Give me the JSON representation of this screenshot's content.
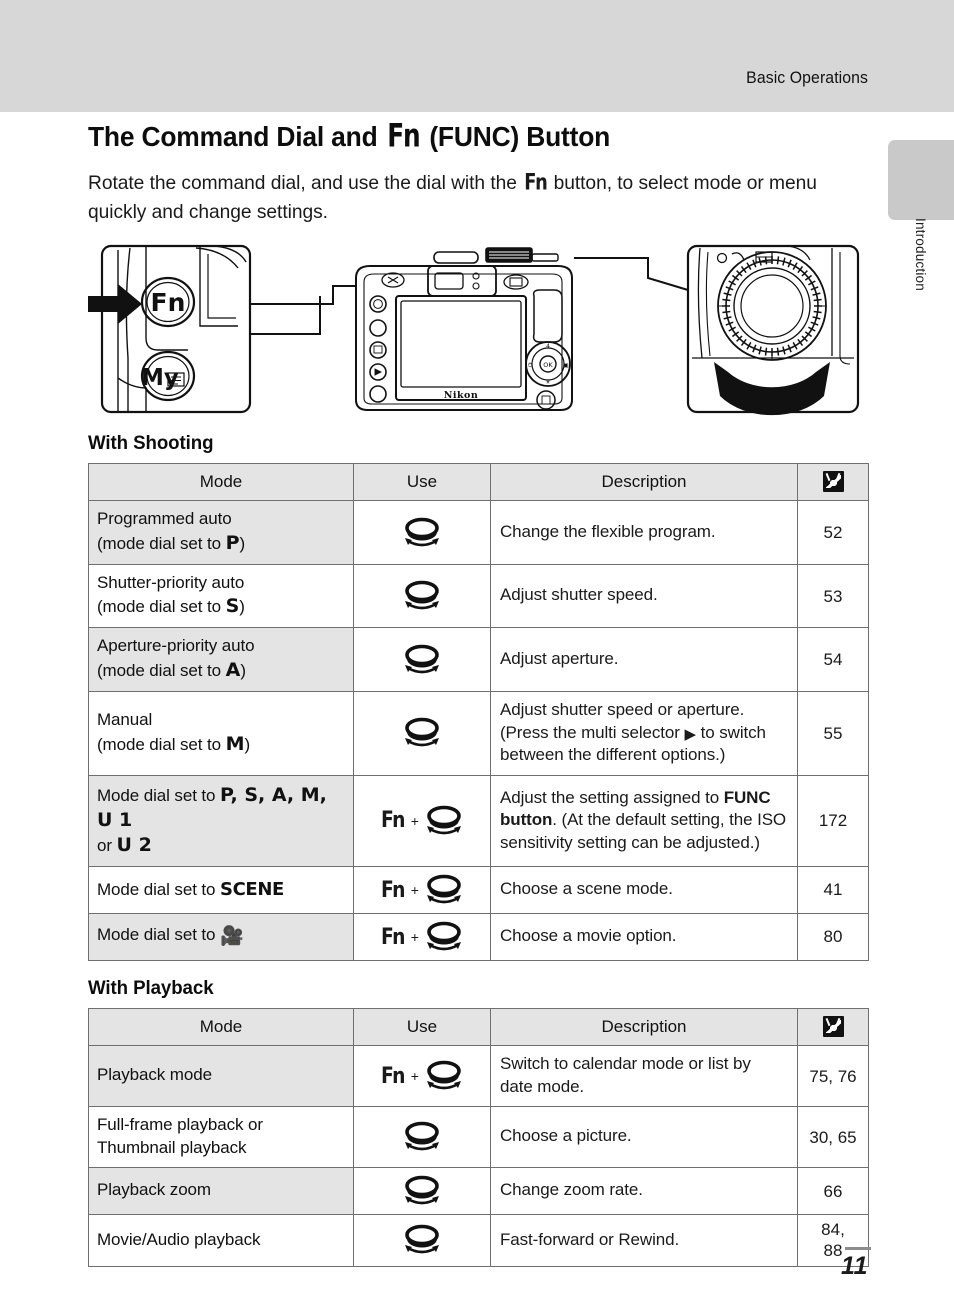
{
  "header": {
    "running_head": "Basic Operations"
  },
  "side_tab": {
    "label": "Introduction"
  },
  "section": {
    "title_before": "The Command Dial and ",
    "title_fn": "Fn",
    "title_after": " (FUNC) Button",
    "intro_before": "Rotate the command dial, and use the dial with the ",
    "intro_fn": "Fn",
    "intro_after": " button, to select mode or menu quickly and change settings."
  },
  "figure": {
    "name": "camera-command-dial-diagram",
    "fn_button_label": "Fn",
    "my_button_label": "My",
    "brand_label": "Nikon"
  },
  "shooting": {
    "heading": "With Shooting",
    "columns": [
      "Mode",
      "Use",
      "Description",
      "book-icon"
    ],
    "rows": [
      {
        "mode_line1": "Programmed auto",
        "mode_line2_before": "(mode dial set to ",
        "mode_letter": "P",
        "mode_line2_after": ")",
        "use": "dial",
        "desc": "Change the flexible program.",
        "page": "52"
      },
      {
        "mode_line1": "Shutter-priority auto",
        "mode_line2_before": "(mode dial set to ",
        "mode_letter": "S",
        "mode_line2_after": ")",
        "use": "dial",
        "desc": "Adjust shutter speed.",
        "page": "53"
      },
      {
        "mode_line1": "Aperture-priority auto",
        "mode_line2_before": "(mode dial set to ",
        "mode_letter": "A",
        "mode_line2_after": ")",
        "use": "dial",
        "desc": "Adjust aperture.",
        "page": "54"
      },
      {
        "mode_line1": "Manual",
        "mode_line2_before": "(mode dial set to ",
        "mode_letter": "M",
        "mode_line2_after": ")",
        "use": "dial",
        "desc_part1": "Adjust shutter speed or aperture. (Press the multi selector ",
        "desc_arrow": "▶",
        "desc_part2": " to switch between the different options.)",
        "page": "55"
      },
      {
        "mode_prefix": "Mode dial set to ",
        "mode_letters": "P, S, A, M, U 1",
        "mode_or": "or",
        "mode_letters2": "U 2",
        "use": "fn+dial",
        "desc_part1": "Adjust the setting assigned to ",
        "desc_bold": "FUNC button",
        "desc_part2": ". (At the default setting, the ISO sensitivity setting can be adjusted.)",
        "page": "172"
      },
      {
        "mode_prefix": "Mode dial set to ",
        "mode_scene": "SCENE",
        "use": "fn+dial",
        "desc": "Choose a scene mode.",
        "page": "41"
      },
      {
        "mode_prefix": "Mode dial set to ",
        "mode_movie_icon": "movie-camera-icon",
        "use": "fn+dial",
        "desc": "Choose a movie option.",
        "page": "80"
      }
    ]
  },
  "playback": {
    "heading": "With Playback",
    "columns": [
      "Mode",
      "Use",
      "Description",
      "book-icon"
    ],
    "rows": [
      {
        "mode": "Playback mode",
        "use": "fn+dial",
        "desc": "Switch to calendar mode or list by date mode.",
        "page": "75, 76"
      },
      {
        "mode_line1": "Full-frame playback or",
        "mode_line2": "Thumbnail playback",
        "use": "dial",
        "desc": "Choose a picture.",
        "page": "30, 65"
      },
      {
        "mode": "Playback zoom",
        "use": "dial",
        "desc": "Change zoom rate.",
        "page": "66"
      },
      {
        "mode": "Movie/Audio playback",
        "use": "dial",
        "desc": "Fast-forward or Rewind.",
        "page_line1": "84,",
        "page_line2": "88"
      }
    ]
  },
  "footer": {
    "page_number": "11"
  },
  "colors": {
    "band": "#d7d7d7",
    "tab": "#c9c9c9",
    "table_head": "#e4e4e4",
    "table_border": "#6f6f6f"
  }
}
